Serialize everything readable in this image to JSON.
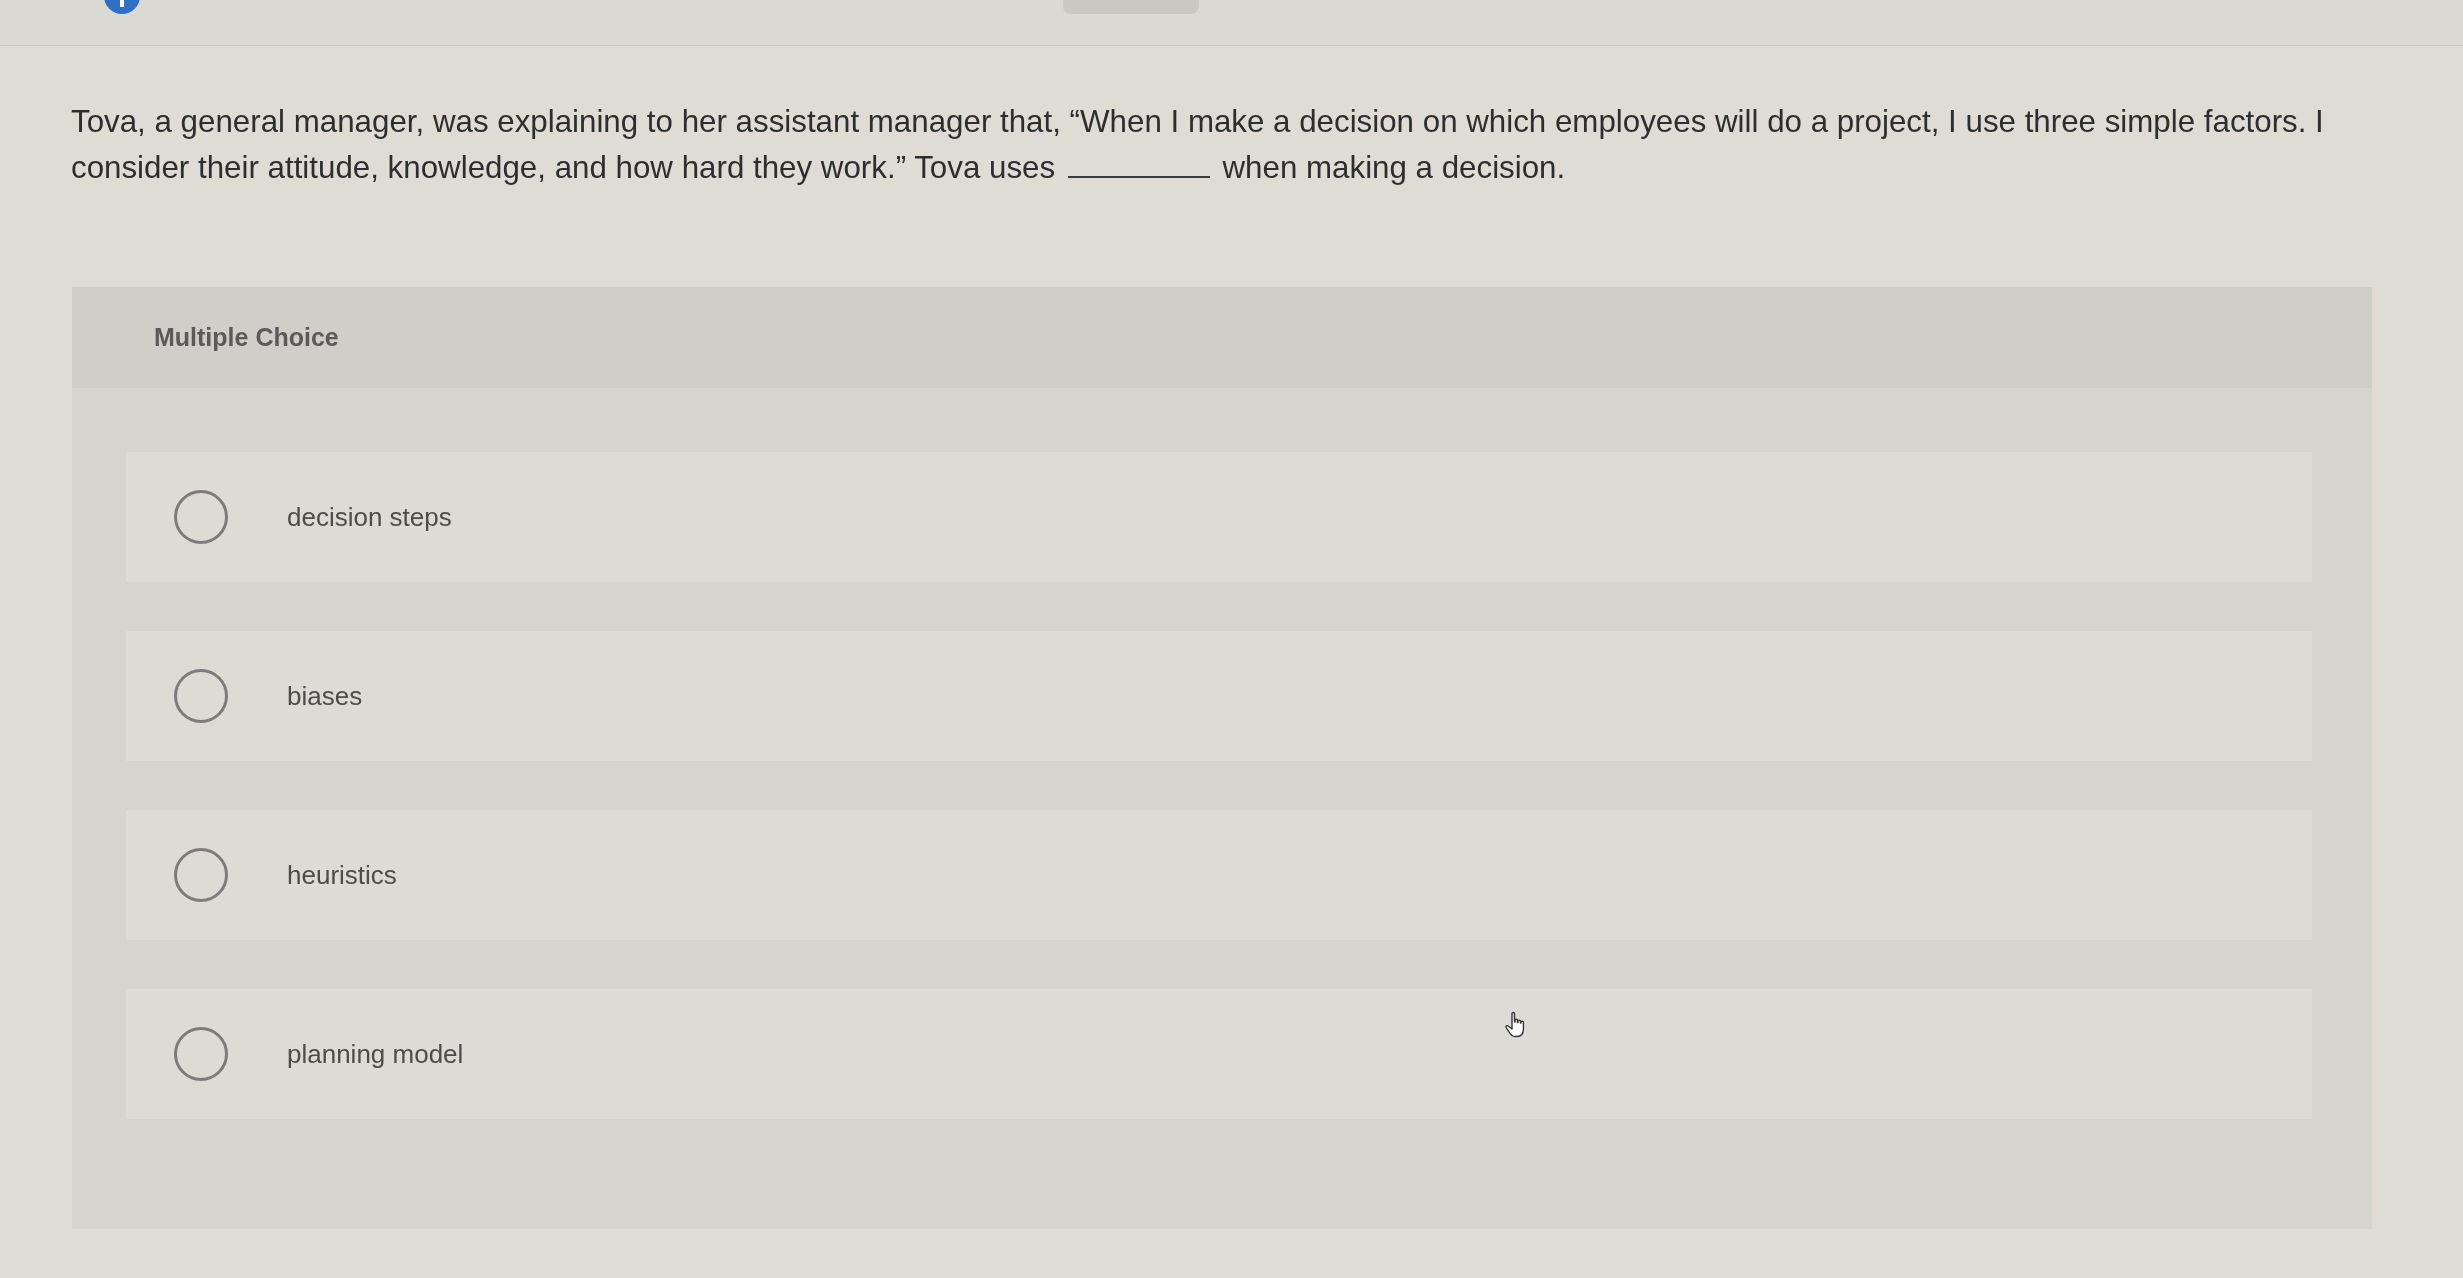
{
  "question": {
    "text_before": "Tova, a general manager, was explaining to her assistant manager that, “When I make a decision on which employees will do a project, I use three simple factors. I consider their attitude, knowledge, and how hard they work.” Tova uses",
    "text_after": "when making a decision."
  },
  "answer_panel": {
    "type_label": "Multiple Choice",
    "options": [
      {
        "label": "decision steps",
        "selected": false
      },
      {
        "label": "biases",
        "selected": false
      },
      {
        "label": "heuristics",
        "selected": false
      },
      {
        "label": "planning model",
        "selected": false
      }
    ]
  }
}
